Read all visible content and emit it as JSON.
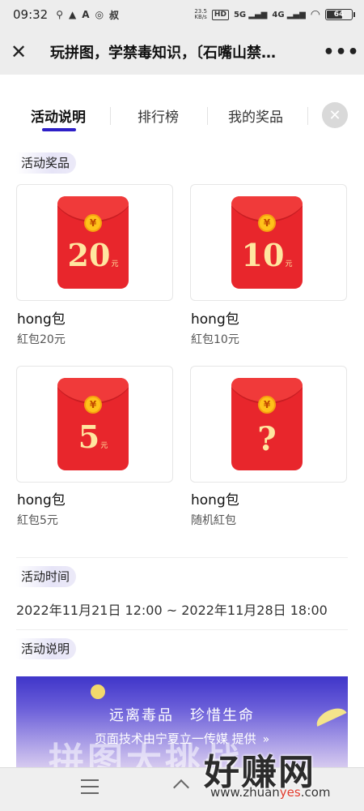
{
  "status_bar": {
    "time": "09:32",
    "notif_icons": [
      "map-pin-icon",
      "alert-icon",
      "a-icon",
      "circle-app-icon",
      "uncle-icon"
    ],
    "speed_value": "23.5",
    "speed_unit": "KB/s",
    "hd_badge": "HD",
    "signal_5g": "5G",
    "signal_4g": "4G",
    "battery_level": "64"
  },
  "titlebar": {
    "close_icon": "close-icon",
    "title": "玩拼图，学禁毒知识，〔石嘴山禁…",
    "more_icon": "more-icon"
  },
  "tabs": [
    {
      "label": "活动说明",
      "active": true
    },
    {
      "label": "排行榜",
      "active": false
    },
    {
      "label": "我的奖品",
      "active": false
    }
  ],
  "accent_color": "#2d1fc7",
  "prizes_section": {
    "label": "活动奖品"
  },
  "prizes": [
    {
      "amount": "20",
      "unit": "元",
      "name": "hong包",
      "desc": "紅包20元"
    },
    {
      "amount": "10",
      "unit": "元",
      "name": "hong包",
      "desc": "紅包10元"
    },
    {
      "amount": "5",
      "unit": "元",
      "name": "hong包",
      "desc": "紅包5元"
    },
    {
      "amount": "?",
      "unit": "",
      "name": "hong包",
      "desc": "随机紅包"
    }
  ],
  "time_section": {
    "label": "活动时间",
    "value": "2022年11月21日 12:00 ~ 2022年11月28日 18:00"
  },
  "desc_section": {
    "label": "活动说明"
  },
  "banner": {
    "title": "远离毒品　珍惜生命",
    "big_text": "拼图大挑战"
  },
  "credit": {
    "text": "页面技术由宁夏立一传媒 提供",
    "arrow": "»"
  },
  "watermark": {
    "big": "好赚网",
    "url_prefix": "www.zhuan",
    "url_highlight": "yes",
    "url_suffix": ".com"
  }
}
